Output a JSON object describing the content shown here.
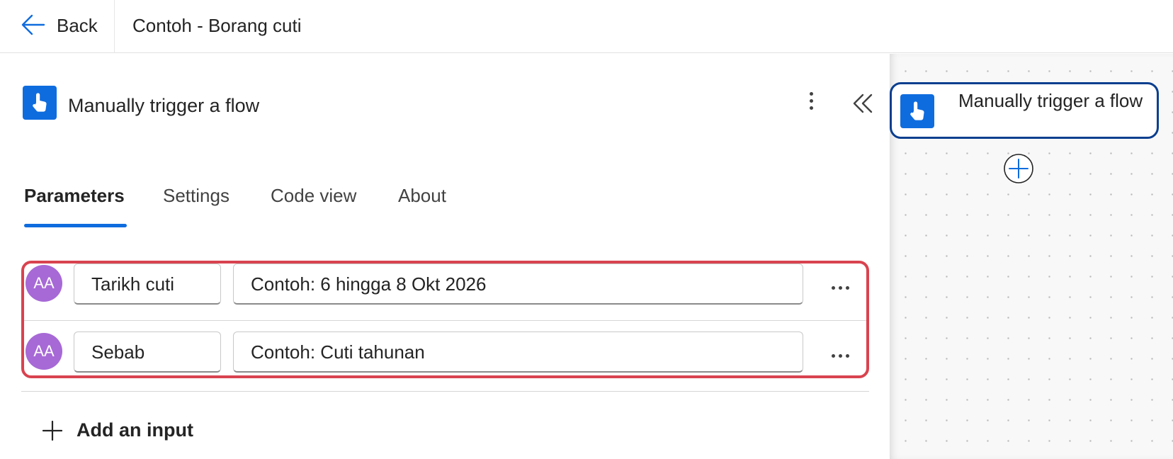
{
  "header": {
    "back_label": "Back",
    "flow_title": "Contoh - Borang cuti"
  },
  "panel": {
    "title": "Manually trigger a flow",
    "tabs": [
      {
        "label": "Parameters",
        "active": true
      },
      {
        "label": "Settings",
        "active": false
      },
      {
        "label": "Code view",
        "active": false
      },
      {
        "label": "About",
        "active": false
      }
    ],
    "inputs": [
      {
        "avatar": "AA",
        "name": "Tarikh cuti",
        "description": "Contoh: 6 hingga 8 Okt 2026"
      },
      {
        "avatar": "AA",
        "name": "Sebab",
        "description": "Contoh: Cuti tahunan"
      }
    ],
    "add_input_label": "Add an input"
  },
  "canvas": {
    "node_label": "Manually trigger a flow"
  },
  "icons": {
    "back": "arrow-left-icon",
    "trigger": "touch-hand-icon",
    "more": "more-vertical-icon",
    "collapse": "double-chevron-left-icon",
    "row_more": "more-horizontal-icon",
    "add": "plus-icon",
    "add_step": "plus-circle-icon"
  },
  "colors": {
    "accent": "#0f6cde",
    "highlight_border": "#d9434f",
    "avatar": "#a769d6",
    "node_border": "#0a3f8f"
  }
}
